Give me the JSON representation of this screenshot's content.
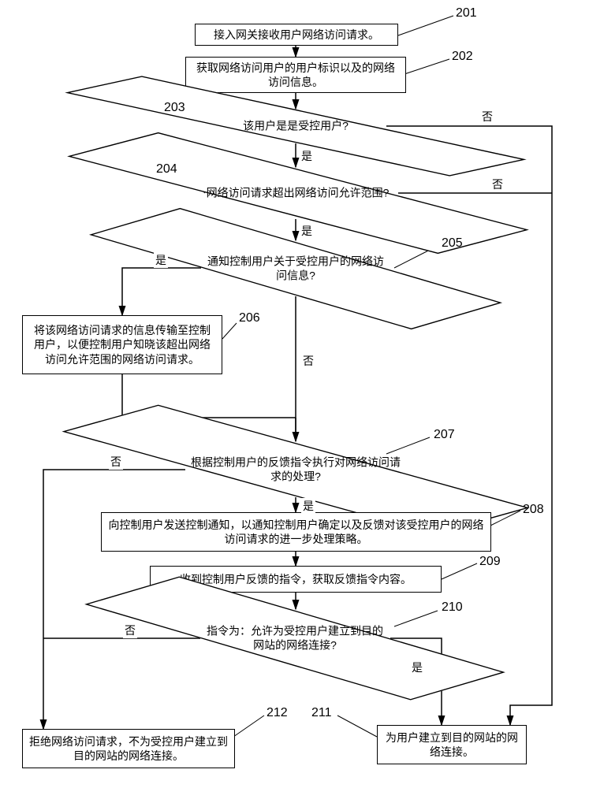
{
  "chart_data": {
    "type": "flowchart",
    "title": "",
    "nodes": [
      {
        "id": 201,
        "shape": "process",
        "text": "接入网关接收用户网络访问请求。"
      },
      {
        "id": 202,
        "shape": "process",
        "text": "获取网络访问用户的用户标识以及的网络访问信息。"
      },
      {
        "id": 203,
        "shape": "decision",
        "text": "该用户是是受控用户?"
      },
      {
        "id": 204,
        "shape": "decision",
        "text": "网络访问请求超出网络访问允许范围?"
      },
      {
        "id": 205,
        "shape": "decision",
        "text": "通知控制用户关于受控用户的网络访问信息?"
      },
      {
        "id": 206,
        "shape": "process",
        "text": "将该网络访问请求的信息传输至控制用户，以便控制用户知晓该超出网络访问允许范围的网络访问请求。"
      },
      {
        "id": 207,
        "shape": "decision",
        "text": "根据控制用户的反馈指令执行对网络访问请求的处理?"
      },
      {
        "id": 208,
        "shape": "process",
        "text": "向控制用户发送控制通知，以通知控制用户确定以及反馈对该受控用户的网络访问请求的进一步处理策略。"
      },
      {
        "id": 209,
        "shape": "process",
        "text": "收到控制用户反馈的指令，获取反馈指令内容。"
      },
      {
        "id": 210,
        "shape": "decision",
        "text": "指令为：允许为受控用户建立到目的网站的网络连接?"
      },
      {
        "id": 211,
        "shape": "process",
        "text": "为用户建立到目的网站的网络连接。"
      },
      {
        "id": 212,
        "shape": "process",
        "text": "拒绝网络访问请求，不为受控用户建立到目的网站的网络连接。"
      }
    ],
    "edges": [
      {
        "from": 201,
        "to": 202,
        "label": ""
      },
      {
        "from": 202,
        "to": 203,
        "label": ""
      },
      {
        "from": 203,
        "to": 204,
        "branch": "是"
      },
      {
        "from": 203,
        "to": 211,
        "branch": "否"
      },
      {
        "from": 204,
        "to": 205,
        "branch": "是"
      },
      {
        "from": 204,
        "to": 211,
        "branch": "否"
      },
      {
        "from": 205,
        "to": 206,
        "branch": "是"
      },
      {
        "from": 205,
        "to": 207,
        "branch": "否"
      },
      {
        "from": 206,
        "to": 207,
        "label": ""
      },
      {
        "from": 207,
        "to": 208,
        "branch": "是"
      },
      {
        "from": 207,
        "to": 212,
        "branch": "否"
      },
      {
        "from": 208,
        "to": 209,
        "label": ""
      },
      {
        "from": 209,
        "to": 210,
        "label": ""
      },
      {
        "from": 210,
        "to": 211,
        "branch": "是"
      },
      {
        "from": 210,
        "to": 212,
        "branch": "否"
      }
    ],
    "yes_label": "是",
    "no_label": "否"
  },
  "nodes": {
    "n201": "接入网关接收用户网络访问请求。",
    "n202": "获取网络访问用户的用户标识以及的网络访问信息。",
    "n203": "该用户是是受控用户?",
    "n204": "网络访问请求超出网络访问允许范围?",
    "n205": "通知控制用户关于受控用户的网络访问信息?",
    "n206": "将该网络访问请求的信息传输至控制用户，以便控制用户知晓该超出网络访问允许范围的网络访问请求。",
    "n207": "根据控制用户的反馈指令执行对网络访问请求的处理?",
    "n208": "向控制用户发送控制通知，以通知控制用户确定以及反馈对该受控用户的网络访问请求的进一步处理策略。",
    "n209": "收到控制用户反馈的指令，获取反馈指令内容。",
    "n210": "指令为：允许为受控用户建立到目的网站的网络连接?",
    "n211": "为用户建立到目的网站的网络连接。",
    "n212": "拒绝网络访问请求，不为受控用户建立到目的网站的网络连接。"
  },
  "numbers": {
    "n201": "201",
    "n202": "202",
    "n203": "203",
    "n204": "204",
    "n205": "205",
    "n206": "206",
    "n207": "207",
    "n208": "208",
    "n209": "209",
    "n210": "210",
    "n211": "211",
    "n212": "212"
  },
  "labels": {
    "yes": "是",
    "no": "否"
  }
}
